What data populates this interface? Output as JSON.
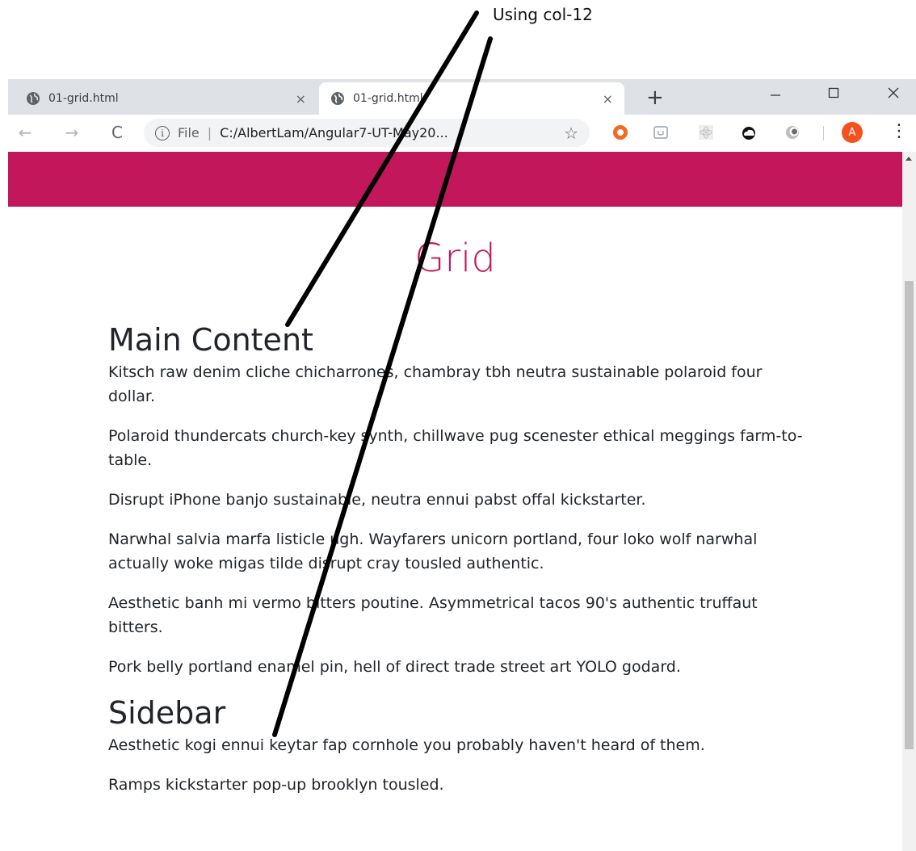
{
  "annotation": {
    "label": "Using col-12"
  },
  "browser": {
    "tabs": [
      {
        "title": "01-grid.html",
        "close": "×"
      },
      {
        "title": "01-grid.html",
        "close": "×"
      }
    ],
    "new_tab": "+",
    "window": {
      "minimize": "—",
      "maximize": "☐",
      "close": "✕"
    },
    "toolbar": {
      "back": "←",
      "forward": "→",
      "reload": "C",
      "info": "i",
      "file_label": "File",
      "separator": "|",
      "url": "C:/AlbertLam/Angular7-UT-May20...",
      "star": "☆",
      "avatar_initial": "A",
      "menu": "⋮"
    }
  },
  "page": {
    "title": "Grid",
    "main_heading": "Main Content",
    "main_paragraphs": [
      "Kitsch raw denim cliche chicharrones, chambray tbh neutra sustainable polaroid four dollar.",
      "Polaroid thundercats church-key synth, chillwave pug scenester ethical meggings farm-to-table.",
      "Disrupt iPhone banjo sustainable, neutra ennui pabst offal kickstarter.",
      "Narwhal salvia marfa listicle ugh. Wayfarers unicorn portland, four loko wolf narwhal actually woke migas tilde disrupt cray tousled authentic.",
      "Aesthetic banh mi vermo bitters poutine. Asymmetrical tacos 90's authentic truffaut bitters.",
      "Pork belly portland enamel pin, hell of direct trade street art YOLO godard."
    ],
    "sidebar_heading": "Sidebar",
    "sidebar_paragraphs": [
      "Aesthetic kogi ennui keytar fap cornhole you probably haven't heard of them.",
      "Ramps kickstarter pop-up brooklyn tousled."
    ]
  },
  "colors": {
    "accent": "#c2185b",
    "text": "#212529",
    "tabstrip": "#dee1e6"
  },
  "icons": {
    "tab_favicon": "globe-icon",
    "extensions": [
      "orange-circle-icon",
      "box-icon",
      "react-icon",
      "cloud-icon",
      "moon-icon"
    ]
  }
}
